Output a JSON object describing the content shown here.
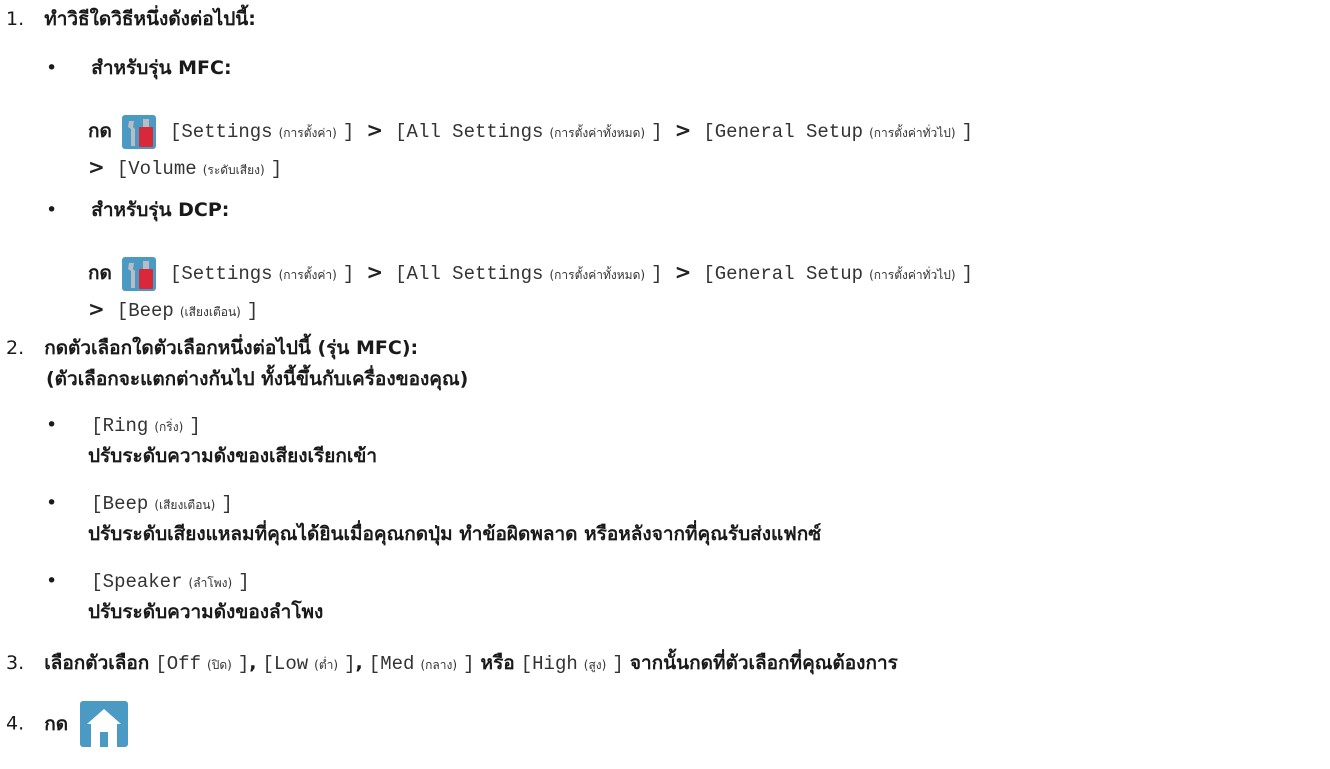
{
  "step1": {
    "num": "1.",
    "title": "ทำวิธีใดวิธีหนึ่งดังต่อไปนี้:",
    "mfc_heading": "สำหรับรุ่น MFC:",
    "dcp_heading": "สำหรับรุ่น DCP:",
    "press": "กด",
    "settings": "[Settings",
    "settings_th": "(การตั้งค่า)",
    "close": "]",
    "all_settings": "[All Settings",
    "all_settings_th": "(การตั้งค่าทั้งหมด)",
    "general_setup": "[General Setup",
    "general_setup_th": "(การตั้งค่าทั่วไป)",
    "volume": "[Volume",
    "volume_th": "(ระดับเสียง)",
    "beep": "[Beep",
    "beep_th": "(เสียงเตือน)",
    "gt": ">"
  },
  "step2": {
    "num": "2.",
    "title": "กดตัวเลือกใดตัวเลือกหนึ่งต่อไปนี้ (รุ่น MFC):",
    "subtitle": "(ตัวเลือกจะแตกต่างกันไป ทั้งนี้ขึ้นกับเครื่องของคุณ)",
    "items": [
      {
        "code": "[Ring",
        "code_th": "(กริ่ง)",
        "close": "]",
        "desc": "ปรับระดับความดังของเสียงเรียกเข้า"
      },
      {
        "code": "[Beep",
        "code_th": "(เสียงเตือน)",
        "close": "]",
        "desc": "ปรับระดับเสียงแหลมที่คุณได้ยินเมื่อคุณกดปุ่ม ทำข้อผิดพลาด หรือหลังจากที่คุณรับส่งแฟกซ์"
      },
      {
        "code": "[Speaker",
        "code_th": "(ลำโพง)",
        "close": "]",
        "desc": "ปรับระดับความดังของลำโพง"
      }
    ]
  },
  "step3": {
    "num": "3.",
    "lead": "เลือกตัวเลือก",
    "off": "[Off",
    "off_th": "(ปิด)",
    "low": "[Low",
    "low_th": "(ต่ำ)",
    "med": "[Med",
    "med_th": "(กลาง)",
    "high": "[High",
    "high_th": "(สูง)",
    "close": "]",
    "comma": ",",
    "or": "หรือ",
    "tail": "จากนั้นกดที่ตัวเลือกที่คุณต้องการ"
  },
  "step4": {
    "num": "4.",
    "press": "กด"
  },
  "bullet": "•",
  "icons": {
    "settings": "settings-tools-icon",
    "home": "home-icon"
  },
  "colors": {
    "icon_bg": "#4a9ac4",
    "tool_red": "#d8283a",
    "tool_gray": "#b8bcc4",
    "home_bg": "#4a9ac4"
  }
}
